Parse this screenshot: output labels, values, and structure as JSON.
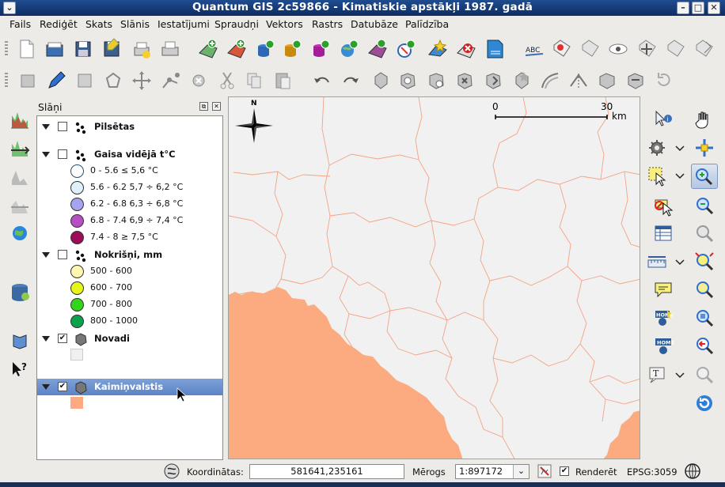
{
  "window": {
    "title": "Quantum GIS 2c59866 - Kimatiskie apstākļi 1987. gadā"
  },
  "menu": [
    "Fails",
    "Rediģēt",
    "Skats",
    "Slānis",
    "Iestatījumi",
    "Spraudņi",
    "Vektors",
    "Rastrs",
    "Datubāze",
    "Palīdzība"
  ],
  "layers_panel": {
    "title": "Slāņi",
    "layers": [
      {
        "name": "Pilsētas",
        "checked": false,
        "kind": "points"
      },
      {
        "name": "Gaisa vidējā t°C",
        "checked": false,
        "kind": "points",
        "classes": [
          {
            "label": "0 - 5.6 ≤ 5,6 °C",
            "color": "#ffffff"
          },
          {
            "label": "5.6 - 6.2 5,7 ÷ 6,2 °C",
            "color": "#dff0fb"
          },
          {
            "label": "6.2 - 6.8 6,3 ÷ 6,8 °C",
            "color": "#a7a3f0"
          },
          {
            "label": "6.8 - 7.4 6,9 ÷ 7,4 °C",
            "color": "#b64fc4"
          },
          {
            "label": "7.4 - 8 ≥ 7,5 °C",
            "color": "#9c0c57"
          }
        ]
      },
      {
        "name": "Nokrišņi, mm",
        "checked": false,
        "kind": "points",
        "classes": [
          {
            "label": "500 - 600",
            "color": "#fff8b3"
          },
          {
            "label": "600 - 700",
            "color": "#e6f41a"
          },
          {
            "label": "700 - 800",
            "color": "#33d41d"
          },
          {
            "label": "800 - 1000",
            "color": "#0aa24a"
          }
        ]
      },
      {
        "name": "Novadi",
        "checked": true,
        "kind": "polygon",
        "fill": "#f0f0f0"
      },
      {
        "name": "Kaimiņvalstis",
        "checked": true,
        "kind": "polygon",
        "fill": "#fcaa80",
        "selected": true
      }
    ]
  },
  "map": {
    "north_label": "N",
    "scale_start": "0",
    "scale_end": "30",
    "scale_unit": "km",
    "background": "#f1f1f1",
    "boundary_color": "#f3a385",
    "neighbour_fill": "#fcaa80"
  },
  "status": {
    "coord_label": "Koordinātas:",
    "coord_value": "581641,235161",
    "scale_label": "Mērogs",
    "scale_value": "1:897172",
    "render_label": "Renderēt",
    "render_checked": true,
    "crs": "EPSG:3059"
  },
  "icons": {
    "toolbar1": [
      "new-project-icon",
      "open-project-icon",
      "save-project-icon",
      "save-as-icon",
      "new-print-composer-icon",
      "print-icon",
      "add-vector-layer-icon",
      "add-raster-layer-icon",
      "add-postgis-layer-icon",
      "add-spatialite-layer-icon",
      "add-mssql-layer-icon",
      "add-wms-layer-icon",
      "add-wfs-layer-icon",
      "add-wcs-layer-icon",
      "new-shapefile-icon",
      "remove-layer-icon",
      "add-csv-layer-icon",
      "label-icon",
      "pin-label-icon",
      "show-hide-labels-icon",
      "preview-labels-icon",
      "move-label-icon",
      "rotate-label-icon",
      "change-label-icon"
    ],
    "toolbar2": [
      "current-edits-icon",
      "toggle-editing-icon",
      "save-edits-icon",
      "add-feature-icon",
      "move-feature-icon",
      "node-tool-icon",
      "delete-selected-icon",
      "cut-features-icon",
      "copy-features-icon",
      "paste-features-icon",
      "undo-icon",
      "redo-icon",
      "simplify-icon",
      "add-ring-icon",
      "add-part-icon",
      "delete-ring-icon",
      "delete-part-icon",
      "reshape-icon",
      "offset-curve-icon",
      "split-features-icon",
      "merge-features-icon",
      "merge-attributes-icon",
      "rotate-point-icon"
    ],
    "left": [
      "histogram-icon",
      "stretch-icon",
      "local-stretch-icon",
      "full-stretch-icon",
      "globe-icon",
      "database-icon",
      "help-book-icon",
      "whats-this-icon"
    ],
    "right": [
      "identify-icon",
      "pan-icon",
      "action-icon",
      "pan-to-selection-icon",
      "select-icon",
      "zoom-in-icon",
      "deselect-icon",
      "zoom-out-icon",
      "attribute-table-icon",
      "zoom-full-icon",
      "measure-icon",
      "zoom-to-selection-icon",
      "map-tips-icon",
      "zoom-to-layer-icon",
      "new-bookmark-icon",
      "zoom-native-icon",
      "show-bookmarks-icon",
      "zoom-last-icon",
      "text-annotation-icon",
      "zoom-next-icon",
      "refresh-icon"
    ]
  }
}
